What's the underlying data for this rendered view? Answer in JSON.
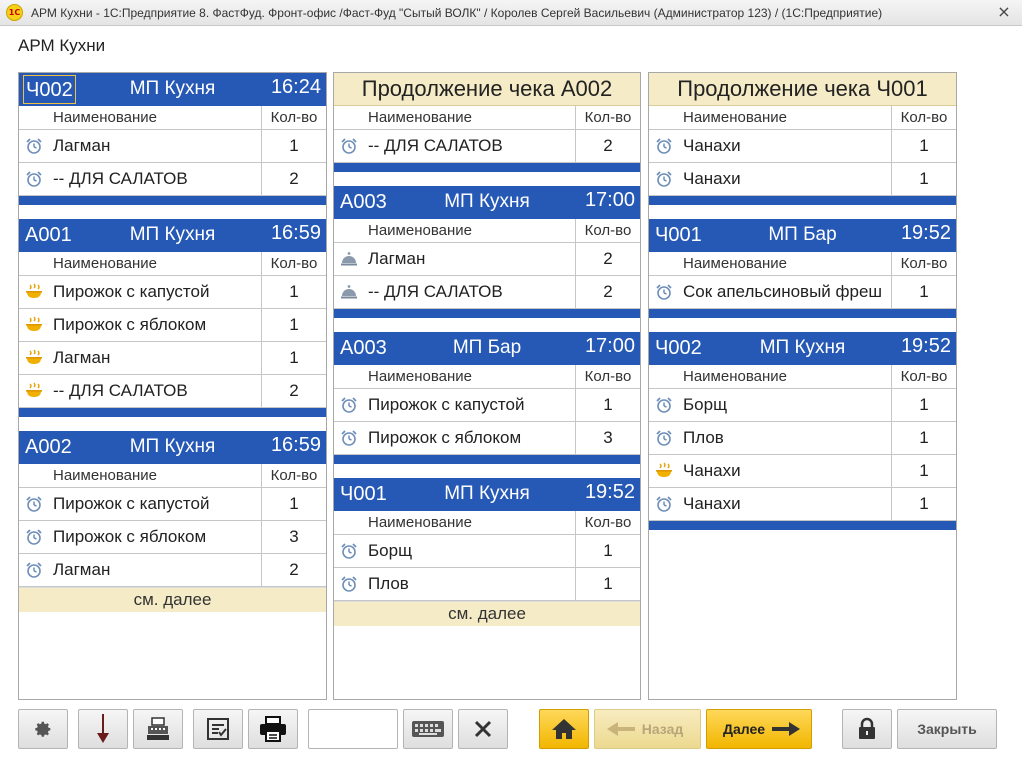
{
  "window": {
    "logo_text": "1С",
    "title": "АРМ Кухни - 1С:Предприятие 8. ФастФуд. Фронт-офис /Фаст-Фуд \"Сытый ВОЛК\" / Королев Сергей Васильевич (Администратор 123) / (1С:Предприятие)",
    "close": "×"
  },
  "form_title": "АРМ Кухни",
  "table_headers": {
    "name": "Наименование",
    "qty": "Кол-во"
  },
  "more_label": "см. далее",
  "columns": [
    {
      "orders": [
        {
          "number": "Ч002",
          "dept": "МП Кухня",
          "time": "16:24",
          "selected": true,
          "items": [
            {
              "icon": "alarm-clock-icon",
              "name": "Лагман",
              "qty": "1"
            },
            {
              "icon": "alarm-clock-icon",
              "name": "-- ДЛЯ САЛАТОВ",
              "qty": "2"
            }
          ]
        },
        {
          "number": "А001",
          "dept": "МП Кухня",
          "time": "16:59",
          "items": [
            {
              "icon": "hot-dish-icon",
              "name": "Пирожок с капустой",
              "qty": "1"
            },
            {
              "icon": "hot-dish-icon",
              "name": "Пирожок с яблоком",
              "qty": "1"
            },
            {
              "icon": "hot-dish-icon",
              "name": "Лагман",
              "qty": "1"
            },
            {
              "icon": "hot-dish-icon",
              "name": "-- ДЛЯ САЛАТОВ",
              "qty": "2"
            }
          ]
        },
        {
          "number": "А002",
          "dept": "МП Кухня",
          "time": "16:59",
          "more": true,
          "items": [
            {
              "icon": "alarm-clock-icon",
              "name": "Пирожок с капустой",
              "qty": "1"
            },
            {
              "icon": "alarm-clock-icon",
              "name": "Пирожок с яблоком",
              "qty": "3"
            },
            {
              "icon": "alarm-clock-icon",
              "name": "Лагман",
              "qty": "2"
            }
          ]
        }
      ]
    },
    {
      "orders": [
        {
          "continuation": "Продолжение чека А002",
          "no_header_row": true,
          "items": [
            {
              "icon": "alarm-clock-icon",
              "name": "-- ДЛЯ САЛАТОВ",
              "qty": "2"
            }
          ]
        },
        {
          "number": "А003",
          "dept": "МП Кухня",
          "time": "17:00",
          "items": [
            {
              "icon": "cloche-icon",
              "name": "Лагман",
              "qty": "2"
            },
            {
              "icon": "cloche-icon",
              "name": "-- ДЛЯ САЛАТОВ",
              "qty": "2"
            }
          ]
        },
        {
          "number": "А003",
          "dept": "МП Бар",
          "time": "17:00",
          "items": [
            {
              "icon": "alarm-clock-icon",
              "name": "Пирожок с капустой",
              "qty": "1"
            },
            {
              "icon": "alarm-clock-icon",
              "name": "Пирожок с яблоком",
              "qty": "3"
            }
          ]
        },
        {
          "number": "Ч001",
          "dept": "МП Кухня",
          "time": "19:52",
          "more": true,
          "no_bar": true,
          "items": [
            {
              "icon": "alarm-clock-icon",
              "name": "Борщ",
              "qty": "1"
            },
            {
              "icon": "alarm-clock-icon",
              "name": "Плов",
              "qty": "1"
            }
          ]
        }
      ]
    },
    {
      "orders": [
        {
          "continuation": "Продолжение чека Ч001",
          "header_row": true,
          "items": [
            {
              "icon": "alarm-clock-icon",
              "name": "Чанахи",
              "qty": "1"
            },
            {
              "icon": "alarm-clock-icon",
              "name": "Чанахи",
              "qty": "1"
            }
          ]
        },
        {
          "number": "Ч001",
          "dept": "МП Бар",
          "time": "19:52",
          "items": [
            {
              "icon": "alarm-clock-icon",
              "name": "Сок апельсиновый фреш",
              "qty": "1"
            }
          ]
        },
        {
          "number": "Ч002",
          "dept": "МП Кухня",
          "time": "19:52",
          "items": [
            {
              "icon": "alarm-clock-icon",
              "name": "Борщ",
              "qty": "1"
            },
            {
              "icon": "alarm-clock-icon",
              "name": "Плов",
              "qty": "1"
            },
            {
              "icon": "hot-dish-icon",
              "name": "Чанахи",
              "qty": "1"
            },
            {
              "icon": "alarm-clock-icon",
              "name": "Чанахи",
              "qty": "1"
            }
          ]
        }
      ]
    }
  ],
  "toolbar": {
    "settings_icon": "gear-icon",
    "down_icon": "down-arrow-icon",
    "register_icon": "cash-register-icon",
    "checklist_icon": "checklist-icon",
    "print_icon": "printer-icon",
    "input_value": "",
    "keyboard_icon": "keyboard-icon",
    "clear_icon": "x-icon",
    "home_icon": "home-icon",
    "back_label": "Назад",
    "next_label": "Далее",
    "lock_icon": "lock-icon",
    "close_label": "Закрыть"
  },
  "colors": {
    "header_blue": "#2659b5",
    "cream": "#f5ecc7",
    "accent_yellow": "#f2b600"
  }
}
